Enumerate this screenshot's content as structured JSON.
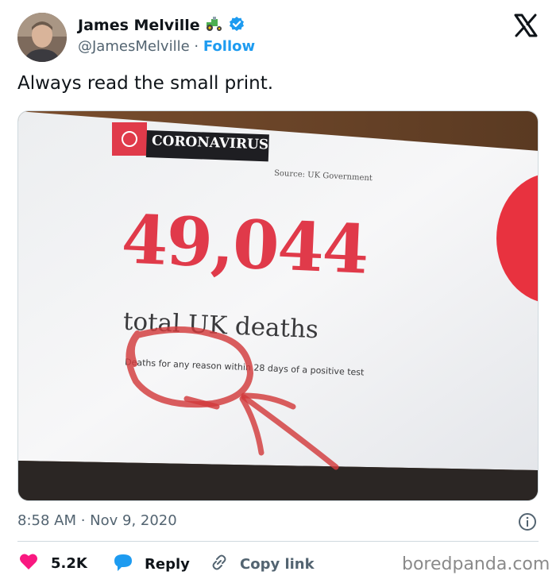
{
  "author": {
    "name": "James Melville",
    "handle": "@JamesMelville",
    "separator": " · ",
    "follow_label": "Follow"
  },
  "tweet": {
    "text": "Always read the small print.",
    "timestamp": "8:58 AM · Nov 9, 2020"
  },
  "media": {
    "brand": "CORONAVIRUS",
    "source": "Source: UK Government",
    "big_number": "49,044",
    "subtitle": "total UK deaths",
    "small_print": "Deaths for any reason within 28 days of a positive test"
  },
  "actions": {
    "like_count": "5.2K",
    "reply_label": "Reply",
    "copy_label": "Copy link"
  },
  "watermark": "boredpanda.com",
  "colors": {
    "follow": "#1d9bf0",
    "like": "#f91880",
    "reply": "#1d9bf0",
    "verified": "#1d9bf0",
    "headline_red": "#e03a4a"
  },
  "icons": [
    "tractor-icon",
    "verified-icon",
    "x-logo-icon",
    "info-icon",
    "heart-icon",
    "reply-bubble-icon",
    "link-icon",
    "virus-icon"
  ]
}
